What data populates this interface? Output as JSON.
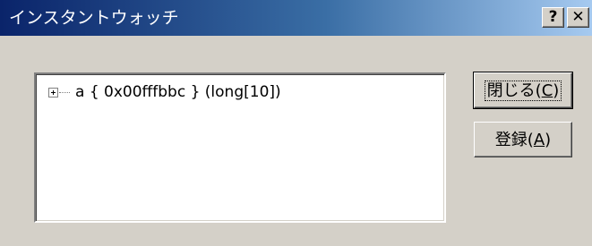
{
  "window": {
    "title": "インスタントウォッチ",
    "help_label": "?",
    "close_label": "✕"
  },
  "watch_list": {
    "items": [
      {
        "expander": "+",
        "text": "a  { 0x00fffbbc } (long[10])"
      }
    ]
  },
  "buttons": {
    "close_prefix": "閉じる(",
    "close_accel": "C",
    "close_suffix": ")",
    "register_prefix": "登録(",
    "register_accel": "A",
    "register_suffix": ")"
  }
}
